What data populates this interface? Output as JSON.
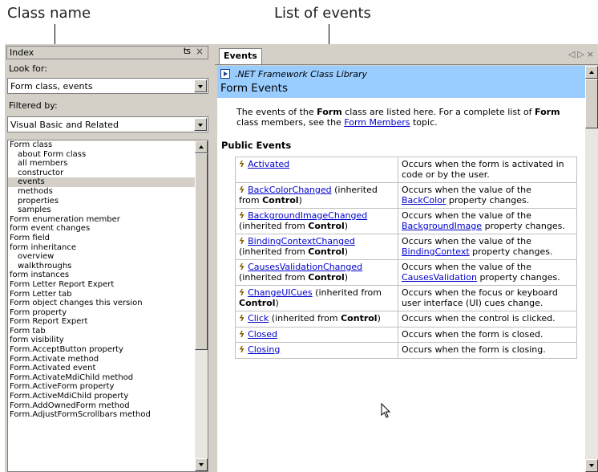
{
  "callouts": {
    "class_name": "Class name",
    "list_of_events": "List of events"
  },
  "index_pane": {
    "title": "Index",
    "look_for_label": "Look for:",
    "look_for_value": "Form class, events",
    "filtered_by_label": "Filtered by:",
    "filtered_by_value": "Visual Basic and Related",
    "items": [
      {
        "text": "Form class",
        "sub": false,
        "selected": false
      },
      {
        "text": "about Form class",
        "sub": true,
        "selected": false
      },
      {
        "text": "all members",
        "sub": true,
        "selected": false
      },
      {
        "text": "constructor",
        "sub": true,
        "selected": false
      },
      {
        "text": "events",
        "sub": true,
        "selected": true
      },
      {
        "text": "methods",
        "sub": true,
        "selected": false
      },
      {
        "text": "properties",
        "sub": true,
        "selected": false
      },
      {
        "text": "samples",
        "sub": true,
        "selected": false
      },
      {
        "text": "Form enumeration member",
        "sub": false,
        "selected": false
      },
      {
        "text": "form event changes",
        "sub": false,
        "selected": false
      },
      {
        "text": "Form field",
        "sub": false,
        "selected": false
      },
      {
        "text": "form inheritance",
        "sub": false,
        "selected": false
      },
      {
        "text": "overview",
        "sub": true,
        "selected": false
      },
      {
        "text": "walkthroughs",
        "sub": true,
        "selected": false
      },
      {
        "text": "form instances",
        "sub": false,
        "selected": false
      },
      {
        "text": "Form Letter Report Expert",
        "sub": false,
        "selected": false
      },
      {
        "text": "Form Letter tab",
        "sub": false,
        "selected": false
      },
      {
        "text": "Form object changes this version",
        "sub": false,
        "selected": false
      },
      {
        "text": "Form property",
        "sub": false,
        "selected": false
      },
      {
        "text": "Form Report Expert",
        "sub": false,
        "selected": false
      },
      {
        "text": "Form tab",
        "sub": false,
        "selected": false
      },
      {
        "text": "form visibility",
        "sub": false,
        "selected": false
      },
      {
        "text": "Form.AcceptButton property",
        "sub": false,
        "selected": false
      },
      {
        "text": "Form.Activate method",
        "sub": false,
        "selected": false
      },
      {
        "text": "Form.Activated event",
        "sub": false,
        "selected": false
      },
      {
        "text": "Form.ActivateMdiChild method",
        "sub": false,
        "selected": false
      },
      {
        "text": "Form.ActiveForm property",
        "sub": false,
        "selected": false
      },
      {
        "text": "Form.ActiveMdiChild property",
        "sub": false,
        "selected": false
      },
      {
        "text": "Form.AddOwnedForm method",
        "sub": false,
        "selected": false
      },
      {
        "text": "Form.AdjustFormScrollbars method",
        "sub": false,
        "selected": false
      }
    ]
  },
  "events_pane": {
    "tab_label": "Events",
    "library": ".NET Framework Class Library",
    "title": "Form Events",
    "intro_1": "The events of the ",
    "intro_bold_1": "Form",
    "intro_2": " class are listed here. For a complete list of ",
    "intro_bold_2": "Form",
    "intro_3": " class members, see the ",
    "intro_link": "Form Members",
    "intro_4": " topic.",
    "section": "Public Events",
    "events": [
      {
        "name": "Activated",
        "inherit_pre": "",
        "inherit_bold": "",
        "inherit_post": "",
        "desc_pre": "Occurs when the form is activated in code or by the user.",
        "desc_link": "",
        "desc_post": ""
      },
      {
        "name": "BackColorChanged",
        "inherit_pre": " (inherited from ",
        "inherit_bold": "Control",
        "inherit_post": ")",
        "desc_pre": "Occurs when the value of the ",
        "desc_link": "BackColor",
        "desc_post": " property changes."
      },
      {
        "name": "BackgroundImageChanged",
        "inherit_pre": " (inherited from ",
        "inherit_bold": "Control",
        "inherit_post": ")",
        "desc_pre": "Occurs when the value of the ",
        "desc_link": "BackgroundImage",
        "desc_post": " property changes."
      },
      {
        "name": "BindingContextChanged",
        "inherit_pre": " (inherited from ",
        "inherit_bold": "Control",
        "inherit_post": ")",
        "desc_pre": "Occurs when the value of the ",
        "desc_link": "BindingContext",
        "desc_post": " property changes."
      },
      {
        "name": "CausesValidationChanged",
        "inherit_pre": " (inherited from ",
        "inherit_bold": "Control",
        "inherit_post": ")",
        "desc_pre": "Occurs when the value of the ",
        "desc_link": "CausesValidation",
        "desc_post": " property changes."
      },
      {
        "name": "ChangeUICues",
        "inherit_pre": " (inherited from ",
        "inherit_bold": "Control",
        "inherit_post": ")",
        "desc_pre": "Occurs when the focus or keyboard user interface (UI) cues change.",
        "desc_link": "",
        "desc_post": ""
      },
      {
        "name": "Click",
        "inherit_pre": " (inherited from ",
        "inherit_bold": "Control",
        "inherit_post": ")",
        "desc_pre": "Occurs when the control is clicked.",
        "desc_link": "",
        "desc_post": ""
      },
      {
        "name": "Closed",
        "inherit_pre": "",
        "inherit_bold": "",
        "inherit_post": "",
        "desc_pre": "Occurs when the form is closed.",
        "desc_link": "",
        "desc_post": ""
      },
      {
        "name": "Closing",
        "inherit_pre": "",
        "inherit_bold": "",
        "inherit_post": "",
        "desc_pre": "Occurs when the form is closing.",
        "desc_link": "",
        "desc_post": ""
      }
    ]
  }
}
